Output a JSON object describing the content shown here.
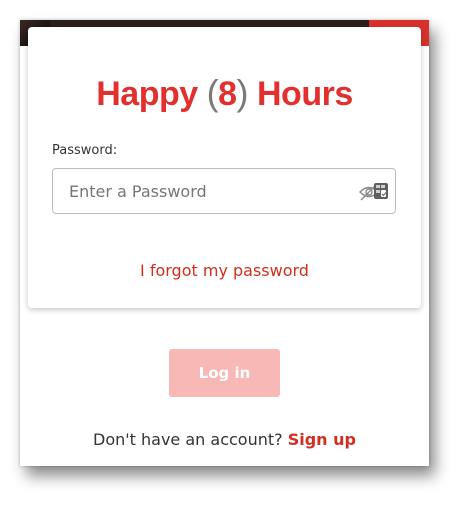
{
  "logo": {
    "word1": "Happy",
    "open_paren": "(",
    "number": "8",
    "close_paren": ")",
    "word2": "Hours",
    "brand_color": "#e2302f"
  },
  "password": {
    "label": "Password:",
    "placeholder": "Enter a Password",
    "value": "",
    "toggle_icon": "eye-slash-icon"
  },
  "forgot_link": "I forgot my password",
  "login_button": {
    "label": "Log in",
    "state": "disabled",
    "color": "#f8b9b6"
  },
  "signup": {
    "prompt": "Don't have an account?",
    "link": "Sign up"
  },
  "accent_color": "#d42e20"
}
